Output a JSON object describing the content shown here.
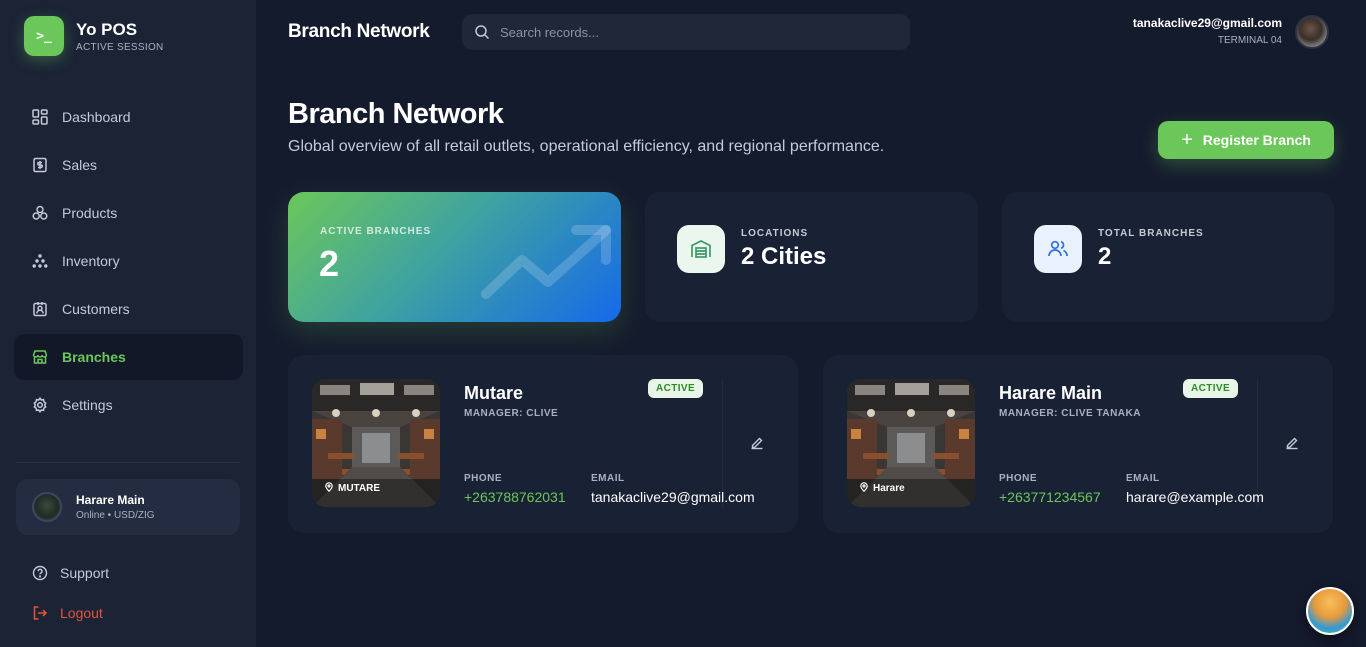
{
  "brand": {
    "logo": ">_",
    "name": "Yo POS",
    "subtitle": "ACTIVE SESSION"
  },
  "sidebar": {
    "items": [
      {
        "label": "Dashboard",
        "icon": "grid-icon"
      },
      {
        "label": "Sales",
        "icon": "receipt-icon"
      },
      {
        "label": "Products",
        "icon": "cubes-icon"
      },
      {
        "label": "Inventory",
        "icon": "boxes-icon"
      },
      {
        "label": "Customers",
        "icon": "id-badge-icon"
      },
      {
        "label": "Branches",
        "icon": "store-icon",
        "active": true
      },
      {
        "label": "Settings",
        "icon": "gear-icon"
      }
    ],
    "store": {
      "name": "Harare Main",
      "status": "Online • USD/ZIG"
    },
    "support_label": "Support",
    "logout_label": "Logout"
  },
  "header": {
    "title": "Branch Network",
    "search_placeholder": "Search records...",
    "user_email": "tanakaclive29@gmail.com",
    "terminal": "TERMINAL 04"
  },
  "page": {
    "title": "Branch Network",
    "subtitle": "Global overview of all retail outlets, operational efficiency, and regional performance.",
    "register_label": "Register Branch"
  },
  "stats": {
    "active": {
      "label": "ACTIVE BRANCHES",
      "value": "2"
    },
    "locations": {
      "label": "LOCATIONS",
      "value": "2 Cities",
      "icon": "warehouse-icon"
    },
    "total": {
      "label": "TOTAL BRANCHES",
      "value": "2",
      "icon": "users-icon"
    }
  },
  "branches": [
    {
      "name": "Mutare",
      "manager": "MANAGER: CLIVE",
      "status": "ACTIVE",
      "photo_tag": "MUTARE",
      "phone_label": "PHONE",
      "phone": "+263788762031",
      "email_label": "EMAIL",
      "email": "tanakaclive29@gmail.com"
    },
    {
      "name": "Harare Main",
      "manager": "MANAGER: CLIVE TANAKA",
      "status": "ACTIVE",
      "photo_tag": "Harare",
      "phone_label": "PHONE",
      "phone": "+263771234567",
      "email_label": "EMAIL",
      "email": "harare@example.com"
    }
  ],
  "colors": {
    "accent": "#6cc75a",
    "background": "#141b2d",
    "sidebar": "#1b2335",
    "card": "#192135",
    "danger": "#e0563a",
    "blue": "#1669ea"
  }
}
